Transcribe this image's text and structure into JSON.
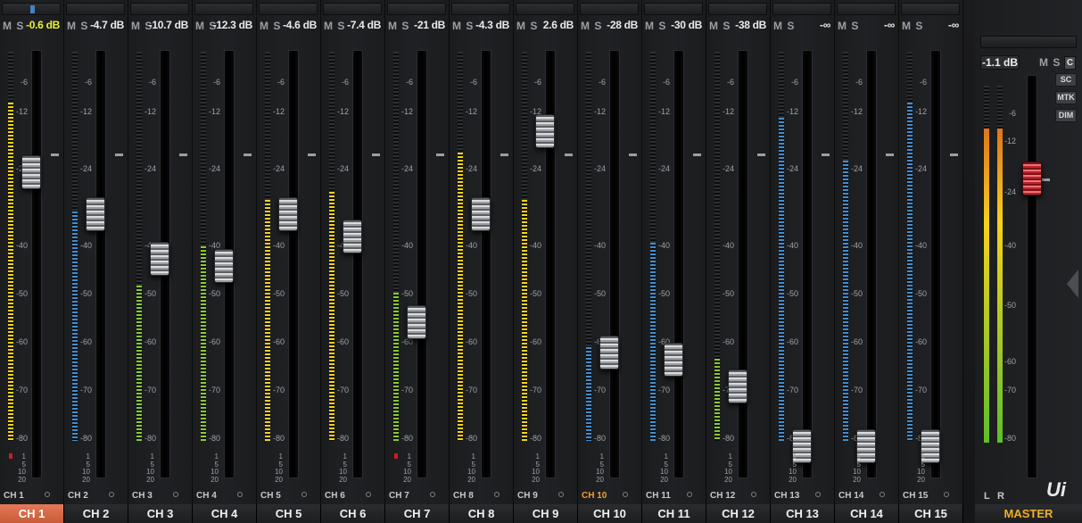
{
  "channels": [
    {
      "label": "CH 1",
      "short": "CH 1",
      "gain": "-0.6 dB",
      "gain_color": "#e8f13b",
      "selected": true,
      "fader": 0.73,
      "meter": {
        "level": 0.87,
        "color": "#f5d21c"
      }
    },
    {
      "label": "CH 2",
      "short": "CH 2",
      "gain": "-4.7 dB",
      "fader": 0.62,
      "meter": {
        "level": 0.59,
        "color": "#3f8fd0"
      }
    },
    {
      "label": "CH 3",
      "short": "CH 3",
      "gain": "-10.7 dB",
      "fader": 0.5,
      "meter": {
        "level": 0.4,
        "color": "#8acb2a"
      }
    },
    {
      "label": "CH 4",
      "short": "CH 4",
      "gain": "-12.3 dB",
      "fader": 0.48,
      "meter": {
        "level": 0.5,
        "color": "#8acb2a"
      }
    },
    {
      "label": "CH 5",
      "short": "CH 5",
      "gain": "-4.6 dB",
      "fader": 0.62,
      "meter": {
        "level": 0.62,
        "color": "#f5d21c"
      }
    },
    {
      "label": "CH 6",
      "short": "CH 6",
      "gain": "-7.4 dB",
      "fader": 0.56,
      "meter": {
        "level": 0.64,
        "color": "#f5d21c"
      }
    },
    {
      "label": "CH 7",
      "short": "CH 7",
      "gain": "-21 dB",
      "fader": 0.33,
      "meter": {
        "level": 0.38,
        "color": "#8acb2a"
      }
    },
    {
      "label": "CH 8",
      "short": "CH 8",
      "gain": "-4.3 dB",
      "fader": 0.62,
      "meter": {
        "level": 0.74,
        "color": "#f5d21c"
      }
    },
    {
      "label": "CH 9",
      "short": "CH 9",
      "gain": "2.6 dB",
      "fader": 0.84,
      "meter": {
        "level": 0.62,
        "color": "#f5d21c"
      }
    },
    {
      "label": "CH 10",
      "short": "CH 10",
      "gain": "-28 dB",
      "short_color": "#f0a030",
      "fader": 0.25,
      "meter": {
        "level": 0.24,
        "color": "#3f8fd0"
      }
    },
    {
      "label": "CH 11",
      "short": "CH 11",
      "gain": "-30 dB",
      "fader": 0.23,
      "meter": {
        "level": 0.51,
        "color": "#3f8fd0"
      }
    },
    {
      "label": "CH 12",
      "short": "CH 12",
      "gain": "-38 dB",
      "fader": 0.16,
      "meter": {
        "level": 0.21,
        "color": "#8acb2a"
      }
    },
    {
      "label": "CH 13",
      "short": "CH 13",
      "gain": "-∞",
      "fader": 0.0,
      "meter": {
        "level": 0.83,
        "color": "#3f8fd0"
      }
    },
    {
      "label": "CH 14",
      "short": "CH 14",
      "gain": "-∞",
      "fader": 0.0,
      "meter": {
        "level": 0.72,
        "color": "#3f8fd0"
      }
    },
    {
      "label": "CH 15",
      "short": "CH 15",
      "gain": "-∞",
      "fader": 0.0,
      "meter": {
        "level": 0.87,
        "color": "#3f8fd0"
      }
    }
  ],
  "scale": [
    "-6",
    "-12",
    "-24",
    "-40",
    "-50",
    "-60",
    "-70",
    "-80"
  ],
  "small_scale": [
    "1",
    "5",
    "10",
    "20"
  ],
  "mute_solo": "M S",
  "master": {
    "label": "MASTER",
    "gain": "-1.1 dB",
    "ms": "M S",
    "c": "C",
    "buttons": [
      "SC",
      "MTK",
      "DIM"
    ],
    "left": "L",
    "right": "R",
    "fader": 0.78,
    "meter_level": 0.88,
    "scale": [
      "-6",
      "-12",
      "-24",
      "-40",
      "-50",
      "-60",
      "-70",
      "-80"
    ],
    "logo": "Ui",
    "label_color": "#f0b020"
  },
  "colors": {
    "selected_label": "#d96a46",
    "master_fader": "#d9323a",
    "mute_solo": "#9aa0a6"
  },
  "icons": {
    "edit": "edit-icon",
    "menu": "menu-icon",
    "collapse": "chevron-left-icon"
  }
}
